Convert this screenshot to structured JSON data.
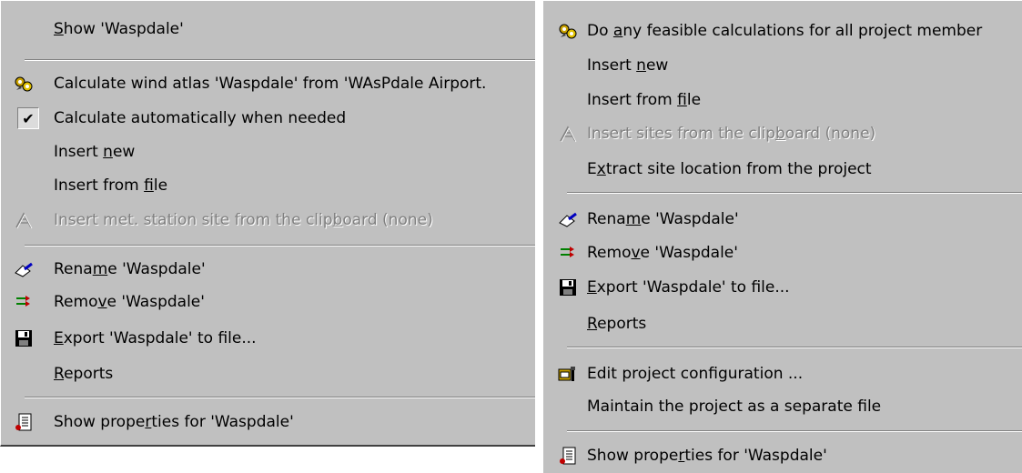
{
  "left_menu": {
    "show": {
      "pre": "",
      "u": "S",
      "post": "how 'Waspdale'"
    },
    "calc_atlas": {
      "pre": "Calculate wind atlas 'Waspdale' from 'WAsPdale Airport.",
      "u": "",
      "post": ""
    },
    "calc_auto": {
      "pre": "Calculate automatically when needed",
      "u": "",
      "post": ""
    },
    "insert_new": {
      "pre": "Insert ",
      "u": "n",
      "post": "ew"
    },
    "insert_file": {
      "pre": "Insert from ",
      "u": "f",
      "post": "ile"
    },
    "insert_clip": {
      "pre": "Insert met. station site from the clip",
      "u": "b",
      "post": "oard (none)"
    },
    "rename": {
      "pre": "Rena",
      "u": "m",
      "post": "e 'Waspdale'"
    },
    "remove": {
      "pre": "Remo",
      "u": "v",
      "post": "e 'Waspdale'"
    },
    "export": {
      "pre": "",
      "u": "E",
      "post": "xport 'Waspdale' to file..."
    },
    "reports": {
      "pre": "",
      "u": "R",
      "post": "eports"
    },
    "properties": {
      "pre": "Show prope",
      "u": "r",
      "post": "ties for 'Waspdale'"
    },
    "check_mark": "✔"
  },
  "right_menu": {
    "calc_all": {
      "pre": "Do ",
      "u": "a",
      "post": "ny feasible calculations for all project member"
    },
    "insert_new": {
      "pre": "Insert ",
      "u": "n",
      "post": "ew"
    },
    "insert_file": {
      "pre": "Insert from ",
      "u": "f",
      "post": "ile"
    },
    "insert_clip": {
      "pre": "Insert sites from the clip",
      "u": "b",
      "post": "oard (none)"
    },
    "extract": {
      "pre": "E",
      "u": "x",
      "post": "tract site location from the project"
    },
    "rename": {
      "pre": "Rena",
      "u": "m",
      "post": "e 'Waspdale'"
    },
    "remove": {
      "pre": "Remo",
      "u": "v",
      "post": "e 'Waspdale'"
    },
    "export": {
      "pre": "",
      "u": "E",
      "post": "xport 'Waspdale' to file..."
    },
    "reports": {
      "pre": "",
      "u": "R",
      "post": "eports"
    },
    "edit_config": {
      "pre": "Edit project configuration ...",
      "u": "",
      "post": ""
    },
    "maintain": {
      "pre": "Maintain the project as a separate file",
      "u": "",
      "post": ""
    },
    "properties": {
      "pre": "Show prope",
      "u": "r",
      "post": "ties for 'Waspdale'"
    }
  },
  "icons": {
    "calculate": "gears-icon",
    "check": "checkmark-icon",
    "clipboard": "paste-sites-icon",
    "rename": "rename-pen-icon",
    "remove": "remove-arrow-icon",
    "export": "floppy-disk-icon",
    "properties": "properties-page-icon",
    "edit_config": "project-config-icon"
  },
  "colors": {
    "menu_bg": "#c0c0c0",
    "disabled_text": "#808080",
    "highlight": "#ffffff"
  }
}
